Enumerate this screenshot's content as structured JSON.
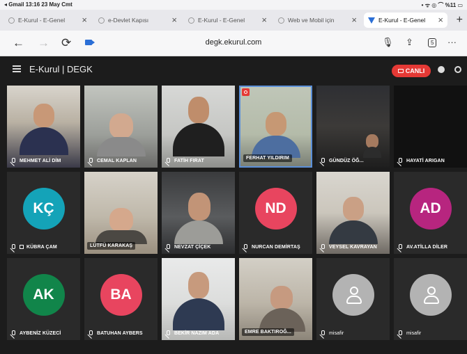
{
  "status_bar": {
    "left": "◂ Gmail  13:16  23 May Cmt",
    "right": "• ᯤ ◎ ⌒ %11 ▭"
  },
  "tabs": [
    {
      "title": "E-Kurul - E-Genel",
      "active": false
    },
    {
      "title": "e-Devlet Kapısı",
      "active": false
    },
    {
      "title": "E-Kurul - E-Genel",
      "active": false
    },
    {
      "title": "Web ve Mobil için",
      "active": false
    },
    {
      "title": "E-Kurul - E-Genel",
      "active": true
    }
  ],
  "browser": {
    "url": "degk.ekurul.com",
    "tab_count": "5",
    "back": "←",
    "forward": "→",
    "reload": "⟳",
    "more": "···"
  },
  "app": {
    "title": "E-Kurul | DEGK",
    "live_label": "CANLI"
  },
  "participants": [
    {
      "name": "MEHMET ALİ DİM",
      "type": "video"
    },
    {
      "name": "CEMAL KAPLAN",
      "type": "video"
    },
    {
      "name": "FATİH FIRAT",
      "type": "video"
    },
    {
      "name": "FERHAT YILDIRIM",
      "type": "video",
      "active": true
    },
    {
      "name": "GÜNDÜZ ÖĞ...",
      "type": "video"
    },
    {
      "name": "HAYATİ ARIGAN",
      "type": "video-off"
    },
    {
      "name": "KÜBRA ÇAM",
      "type": "avatar",
      "initials": "KÇ",
      "color": "#14a3b8"
    },
    {
      "name": "LÜTFÜ KARAKAŞ",
      "type": "video"
    },
    {
      "name": "NEVZAT ÇİÇEK",
      "type": "video"
    },
    {
      "name": "NURCAN DEMİRTAŞ",
      "type": "avatar",
      "initials": "ND",
      "color": "#e8455f"
    },
    {
      "name": "VEYSEL KAVRAYAN",
      "type": "video"
    },
    {
      "name": "AV.ATİLLA DİLER",
      "type": "avatar",
      "initials": "AD",
      "color": "#b7257f"
    },
    {
      "name": "AYBENİZ KÜZECİ",
      "type": "avatar",
      "initials": "AK",
      "color": "#11854a"
    },
    {
      "name": "BATUHAN AYBERS",
      "type": "avatar",
      "initials": "BA",
      "color": "#e8455f"
    },
    {
      "name": "BEKİR NAZIM ADA",
      "type": "video"
    },
    {
      "name": "EMRE BAKTIROĞ...",
      "type": "video"
    },
    {
      "name": "misafir",
      "type": "guest"
    },
    {
      "name": "misafir",
      "type": "guest"
    }
  ]
}
